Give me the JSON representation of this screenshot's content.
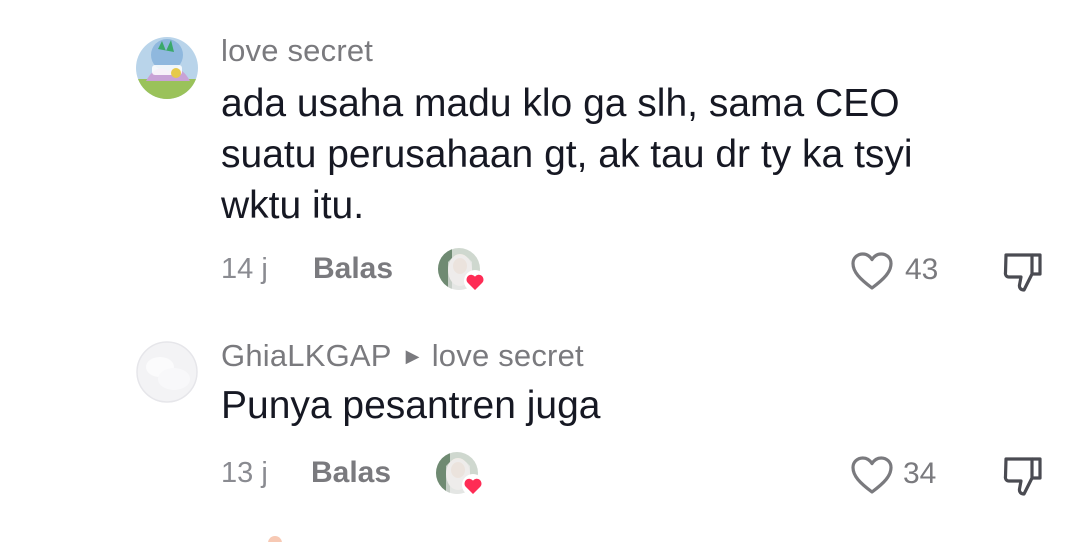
{
  "comments": [
    {
      "username": "love secret",
      "reply_to": "",
      "text_lines": [
        "ada usaha madu klo ga slh, sama CEO",
        "suatu perusahaan gt, ak tau dr ty ka tsyi",
        "wktu itu."
      ],
      "time": "14 j",
      "reply_label": "Balas",
      "likes": "43",
      "liked_by_creator": true
    },
    {
      "username": "GhiaLKGAP",
      "reply_to": "love secret",
      "text_lines": [
        "Punya pesantren juga"
      ],
      "time": "13 j",
      "reply_label": "Balas",
      "likes": "34",
      "liked_by_creator": true
    }
  ],
  "colors": {
    "text": "#161823",
    "secondary": "#7a7a7e",
    "heart": "#fe2c55"
  },
  "icons": {
    "like": "heart-outline-icon",
    "dislike": "thumbs-down-icon",
    "creator_like": "creator-avatar-heart-icon",
    "reply_arrow": "triangle-right-icon"
  }
}
